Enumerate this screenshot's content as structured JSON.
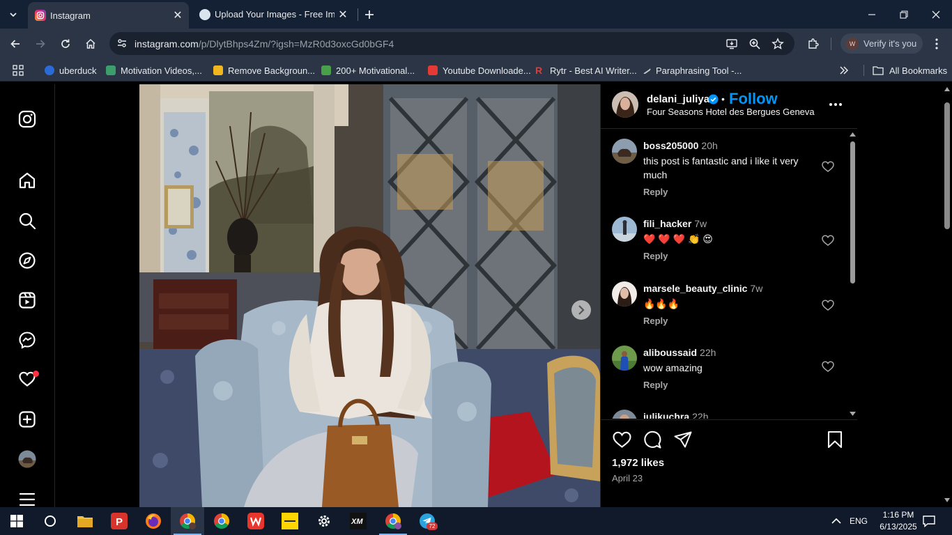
{
  "browser": {
    "tabs": [
      {
        "title": "Instagram",
        "active": true
      },
      {
        "title": "Upload Your Images - Free Imag",
        "active": false
      }
    ],
    "url": {
      "host": "instagram.com",
      "path": "/p/DlytBhps4Zm/?igsh=MzR0d3oxcGd0bGF4"
    },
    "profile_label": "Verify it's you",
    "profile_initial": "W",
    "bookmarks": [
      {
        "label": "uberduck",
        "color": "#2b6bd6"
      },
      {
        "label": "Motivation Videos,...",
        "color": "#3c9e6a"
      },
      {
        "label": "Remove Backgroun...",
        "color": "#f2b61e"
      },
      {
        "label": "200+ Motivational...",
        "color": "#48a04b"
      },
      {
        "label": "Youtube Downloade...",
        "color": "#e53935"
      },
      {
        "label": "Rytr - Best AI Writer...",
        "color": "#e53935"
      },
      {
        "label": "Paraphrasing Tool -...",
        "color": "#c9c9c9"
      }
    ],
    "all_bookmarks_label": "All Bookmarks"
  },
  "instagram": {
    "nav_icons": [
      "instagram-logo-icon",
      "home-icon",
      "search-icon",
      "explore-icon",
      "reels-icon",
      "messenger-icon",
      "heart-icon",
      "create-icon",
      "profile-avatar",
      "menu-icon"
    ],
    "post": {
      "author": "delani_juliya",
      "follow_label": "Follow",
      "separator": "•",
      "location": "Four Seasons Hotel des Bergues Geneva",
      "likes": "1,972 likes",
      "date": "April 23"
    },
    "comments": [
      {
        "user": "boss205000",
        "time": "20h",
        "text": "this post is fantastic and i like it very much",
        "reply": "Reply"
      },
      {
        "user": "fili_hacker",
        "time": "7w",
        "text": "❤️ ❤️ ❤️ 👏 😍",
        "reply": "Reply"
      },
      {
        "user": "marsele_beauty_clinic",
        "time": "7w",
        "text": "🔥🔥🔥",
        "reply": "Reply"
      },
      {
        "user": "aliboussaid",
        "time": "22h",
        "text": "wow amazing",
        "reply": "Reply"
      },
      {
        "user": "julikuchra",
        "time": "22h",
        "text": "",
        "reply": ""
      }
    ]
  },
  "taskbar": {
    "apps": [
      "start-icon",
      "cortana-icon",
      "file-explorer-icon",
      "psiphon-icon",
      "firefox-icon",
      "chrome-profile-icon",
      "chrome-icon",
      "wps-icon",
      "exness-icon",
      "settings-icon",
      "xm-icon",
      "chrome-alt-icon",
      "telegram-icon"
    ],
    "telegram_badge": "72",
    "language": "ENG",
    "time": "1:16 PM",
    "date": "6/13/2025"
  },
  "colors": {
    "ig_blue": "#0095f6",
    "chrome_frame": "#142033",
    "chrome_toolbar": "#2b3545"
  }
}
